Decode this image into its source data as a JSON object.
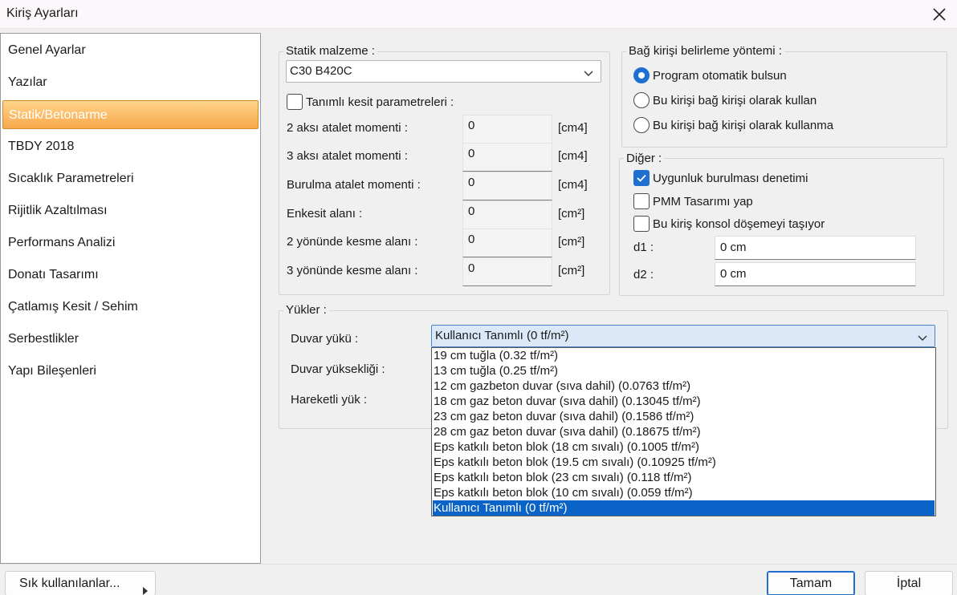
{
  "window": {
    "title": "Kiriş Ayarları"
  },
  "sidebar": {
    "items": [
      {
        "label": "Genel Ayarlar"
      },
      {
        "label": "Yazılar"
      },
      {
        "label": "Statik/Betonarme"
      },
      {
        "label": "TBDY 2018"
      },
      {
        "label": "Sıcaklık Parametreleri"
      },
      {
        "label": "Rijitlik Azaltılması"
      },
      {
        "label": "Performans Analizi"
      },
      {
        "label": "Donatı Tasarımı"
      },
      {
        "label": "Çatlamış Kesit / Sehim"
      },
      {
        "label": "Serbestlikler"
      },
      {
        "label": "Yapı Bileşenleri"
      }
    ],
    "active": "Statik/Betonarme"
  },
  "statik": {
    "legend": "Statik malzeme :",
    "material": "C30 B420C",
    "custom_section_label": "Tanımlı kesit parametreleri :",
    "custom_section_checked": false,
    "rows": [
      {
        "label": "2 aksı atalet momenti :",
        "value": "0",
        "unit": "[cm4]"
      },
      {
        "label": "3 aksı atalet momenti :",
        "value": "0",
        "unit": "[cm4]"
      },
      {
        "label": "Burulma atalet momenti :",
        "value": "0",
        "unit": "[cm4]"
      },
      {
        "label": "Enkesit alanı :",
        "value": "0",
        "unit": "[cm²]"
      },
      {
        "label": "2 yönünde kesme alanı :",
        "value": "0",
        "unit": "[cm²]"
      },
      {
        "label": "3 yönünde kesme alanı :",
        "value": "0",
        "unit": "[cm²]"
      }
    ]
  },
  "bag": {
    "legend": "Bağ kirişi belirleme yöntemi :",
    "options": [
      {
        "label": "Program otomatik bulsun",
        "checked": true
      },
      {
        "label": "Bu kirişi bağ kirişi olarak kullan",
        "checked": false
      },
      {
        "label": "Bu kirişi bağ kirişi olarak kullanma",
        "checked": false
      }
    ]
  },
  "diger": {
    "legend": "Diğer :",
    "checks": [
      {
        "label": "Uygunluk burulması denetimi",
        "checked": true
      },
      {
        "label": "PMM Tasarımı yap",
        "checked": false
      },
      {
        "label": "Bu kiriş konsol döşemeyi taşıyor",
        "checked": false
      }
    ],
    "d1_label": "d1 :",
    "d1_value": "0 cm",
    "d2_label": "d2 :",
    "d2_value": "0 cm"
  },
  "yukler": {
    "legend": "Yükler :",
    "duvar_yuku_label": "Duvar yükü :",
    "duvar_yuksekligi_label": "Duvar yüksekliği :",
    "hareketli_yuk_label": "Hareketli yük :",
    "selected": "Kullanıcı Tanımlı (0 tf/m²)",
    "options": [
      "19 cm tuğla (0.32 tf/m²)",
      "13 cm tuğla (0.25 tf/m²)",
      "12 cm gazbeton duvar (sıva dahil) (0.0763 tf/m²)",
      "18 cm gaz beton duvar (sıva dahil) (0.13045 tf/m²)",
      "23 cm gaz beton duvar  (sıva dahil) (0.1586 tf/m²)",
      "28 cm gaz beton duvar  (sıva dahil) (0.18675 tf/m²)",
      "Eps katkılı beton blok (18 cm sıvalı) (0.1005 tf/m²)",
      "Eps katkılı beton blok (19.5 cm sıvalı) (0.10925 tf/m²)",
      "Eps katkılı beton blok (23 cm sıvalı) (0.118 tf/m²)",
      "Eps katkılı beton blok (10 cm sıvalı) (0.059 tf/m²)",
      "Kullanıcı Tanımlı (0 tf/m²)"
    ]
  },
  "footer": {
    "favorites_label": "Sık kullanılanlar...",
    "ok_label": "Tamam",
    "cancel_label": "İptal"
  },
  "colors": {
    "accent": "#1f6fd1",
    "active_item": "#f7a84a",
    "list_selected": "#0a64c8"
  }
}
